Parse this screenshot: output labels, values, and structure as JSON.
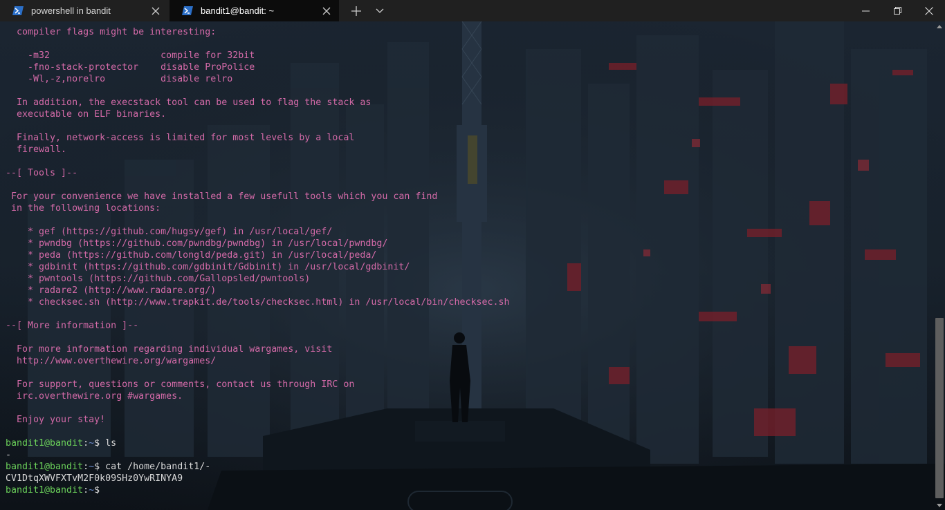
{
  "tabs": [
    {
      "title": "powershell in bandit",
      "icon": "powershell-icon",
      "active": false
    },
    {
      "title": "bandit1@bandit: ~",
      "icon": "powershell-icon",
      "active": true
    }
  ],
  "colors": {
    "text_pink": "#d46aa8",
    "prompt_green": "#6bd15a",
    "path_blue": "#6e8fd1",
    "plain_white": "#d9d9d9",
    "tabbar": "#202020",
    "active_tab": "#0c0c0c"
  },
  "terminal": {
    "text_lines": [
      "  compiler flags might be interesting:",
      "",
      "    -m32                    compile for 32bit",
      "    -fno-stack-protector    disable ProPolice",
      "    -Wl,-z,norelro          disable relro",
      "",
      "  In addition, the execstack tool can be used to flag the stack as",
      "  executable on ELF binaries.",
      "",
      "  Finally, network-access is limited for most levels by a local",
      "  firewall.",
      "",
      "--[ Tools ]--",
      "",
      " For your convenience we have installed a few usefull tools which you can find",
      " in the following locations:",
      "",
      "    * gef (https://github.com/hugsy/gef) in /usr/local/gef/",
      "    * pwndbg (https://github.com/pwndbg/pwndbg) in /usr/local/pwndbg/",
      "    * peda (https://github.com/longld/peda.git) in /usr/local/peda/",
      "    * gdbinit (https://github.com/gdbinit/Gdbinit) in /usr/local/gdbinit/",
      "    * pwntools (https://github.com/Gallopsled/pwntools)",
      "    * radare2 (http://www.radare.org/)",
      "    * checksec.sh (http://www.trapkit.de/tools/checksec.html) in /usr/local/bin/checksec.sh",
      "",
      "--[ More information ]--",
      "",
      "  For more information regarding individual wargames, visit",
      "  http://www.overthewire.org/wargames/",
      "",
      "  For support, questions or comments, contact us through IRC on",
      "  irc.overthewire.org #wargames.",
      "",
      "  Enjoy your stay!",
      ""
    ],
    "prompt_user": "bandit1@bandit",
    "prompt_colon": ":",
    "prompt_path": "~",
    "prompt_symbol": "$ ",
    "commands": [
      {
        "command": "ls",
        "output": "-"
      },
      {
        "command": "cat /home/bandit1/-",
        "output": "CV1DtqXWVFXTvM2F0k09SHz0YwRINYA9"
      },
      {
        "command": "",
        "output": null
      }
    ]
  }
}
